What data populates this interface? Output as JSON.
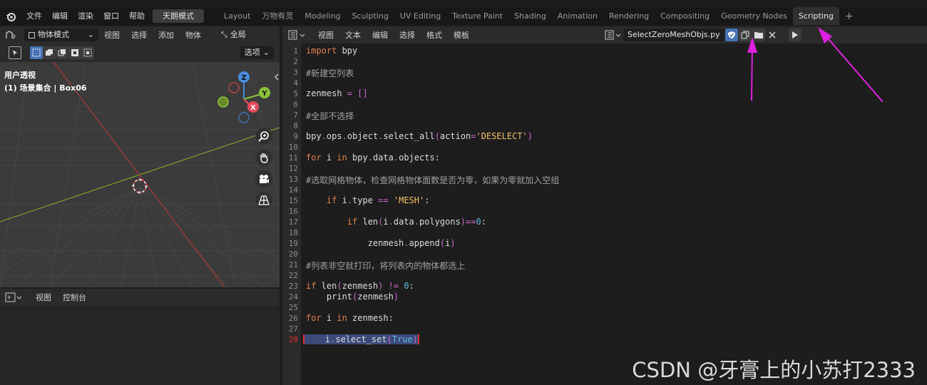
{
  "topbar": {
    "menus": [
      "文件",
      "编辑",
      "渲染",
      "窗口",
      "帮助"
    ],
    "mode_button": "天朗模式",
    "workspace_tabs": [
      "Layout",
      "万物有灵",
      "Modeling",
      "Sculpting",
      "UV Editing",
      "Texture Paint",
      "Shading",
      "Animation",
      "Rendering",
      "Compositing",
      "Geometry Nodes",
      "Scripting"
    ],
    "active_tab": "Scripting",
    "add_tab": "+"
  },
  "viewport": {
    "mode_dropdown": "物体模式",
    "menus": [
      "视图",
      "选择",
      "添加",
      "物体"
    ],
    "transform_label": "全局",
    "options_label": "选项",
    "view_name": "用户透视",
    "collection_info": "(1) 场景集合 | Box06",
    "axis_z": "Z",
    "axis_y": "Y",
    "axis_x": "X"
  },
  "console": {
    "menus": [
      "视图",
      "控制台"
    ]
  },
  "editor": {
    "menus": [
      "视图",
      "文本",
      "编辑",
      "选择",
      "格式",
      "模板"
    ],
    "file_name": "SelectZeroMeshObjs.py",
    "current_line": 28,
    "lines": [
      "import bpy",
      "",
      "#新建空列表",
      "",
      "zenmesh = []",
      "",
      "#全部不选择",
      "",
      "bpy.ops.object.select_all(action='DESELECT')",
      "",
      "for i in bpy.data.objects:",
      "",
      "#选取网格物体，检查网格物体面数是否为零，如果为零就加入空组",
      "",
      "    if i.type == 'MESH':",
      "",
      "        if len(i.data.polygons)==0:",
      "",
      "            zenmesh.append(i)",
      "",
      "#列表非空就打印，将列表内的物体都选上",
      "",
      "if len(zenmesh) != 0:",
      "    print(zenmesh)",
      "",
      "for i in zenmesh:",
      "",
      "    i.select_set(True)"
    ]
  },
  "watermark": "CSDN @牙膏上的小苏打2333",
  "colors": {
    "keyword": "#e37f4d",
    "string": "#f5c26b",
    "number": "#5fb8e0",
    "comment": "#a0a0a0",
    "accent": "#4772b3",
    "arrow": "#e020e0"
  }
}
